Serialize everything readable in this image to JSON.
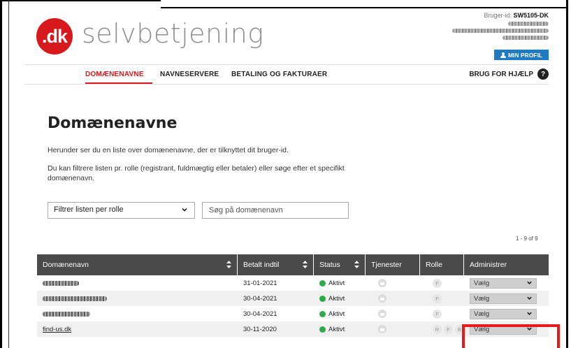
{
  "header": {
    "logo_badge": ".dk",
    "logo_text": "selvbetjening",
    "user_id_label": "Bruger-id:",
    "user_id_value": "SW5105-DK",
    "profile_button": "MIN PROFIL"
  },
  "nav": {
    "items": [
      {
        "label": "DOMÆNENAVNE",
        "active": true
      },
      {
        "label": "NAVNESERVERE",
        "active": false
      },
      {
        "label": "BETALING OG FAKTURAER",
        "active": false
      }
    ],
    "help_label": "BRUG FOR HJÆLP",
    "help_icon": "?"
  },
  "main": {
    "title": "Domænenavne",
    "description1": "Herunder ser du en liste over domænenavne, der er tilknyttet dit bruger-id.",
    "description2": "Du kan filtrere listen pr. rolle (registrant, fuldmægtig eller betaler) eller søge efter et specifikt domænenavn.",
    "role_filter_value": "Filtrer listen per rolle",
    "search_placeholder": "Søg på domænenavn",
    "count": "1 - 9 of 9"
  },
  "table": {
    "columns": [
      "Domænenavn",
      "Betalt indtil",
      "Status",
      "Tjenester",
      "Rolle",
      "Administrer"
    ],
    "rows": [
      {
        "domain": "",
        "paid_until": "31-01-2021",
        "status": "Aktivt",
        "roles": [
          "F"
        ],
        "admin": "Vælg"
      },
      {
        "domain": "",
        "paid_until": "30-04-2021",
        "status": "Aktivt",
        "roles": [
          "F"
        ],
        "admin": "Vælg"
      },
      {
        "domain": "",
        "paid_until": "30-04-2021",
        "status": "Aktivt",
        "roles": [
          "F"
        ],
        "admin": "Vælg"
      },
      {
        "domain": "find-us.dk",
        "paid_until": "30-11-2020",
        "status": "Aktivt",
        "roles": [
          "R",
          "F",
          "B"
        ],
        "admin": "Vælg"
      }
    ]
  },
  "colors": {
    "brand_red": "#d7191e",
    "profile_blue": "#1f7ac2",
    "table_header": "#4a4a4a",
    "status_green": "#2eaa49",
    "highlight_red": "#e61b1b"
  },
  "icons": [
    "person-icon",
    "help-icon",
    "chevron-down-icon",
    "sort-icon",
    "lock-icon",
    "status-dot-icon"
  ]
}
